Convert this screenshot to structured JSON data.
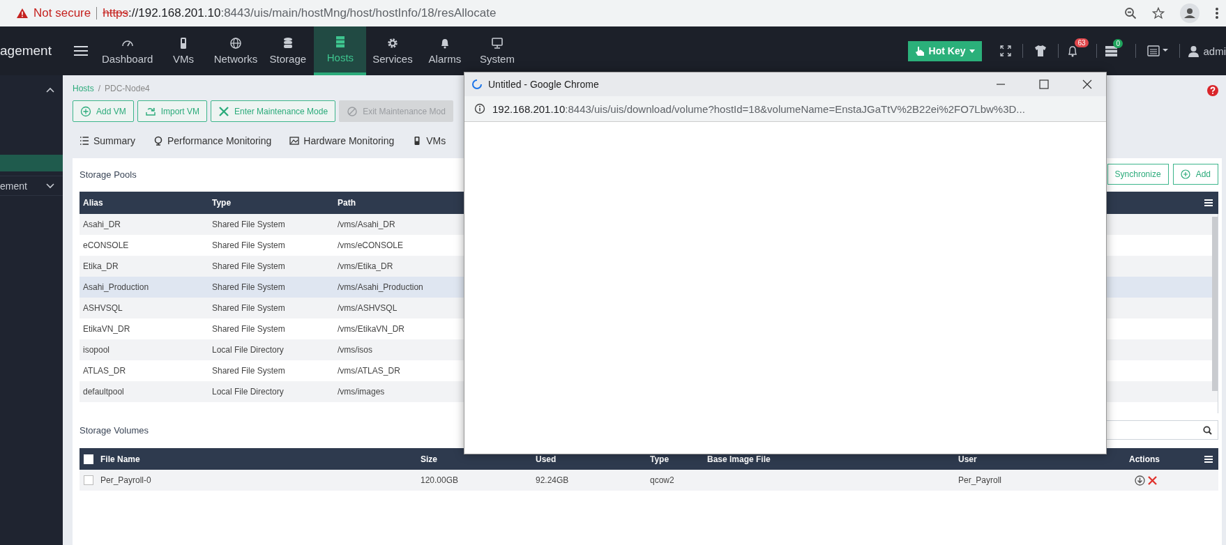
{
  "browser": {
    "security": "Not secure",
    "url": [
      {
        "kind": "scheme",
        "text": "https"
      },
      {
        "kind": "host",
        "text": "://192.168.201.10"
      },
      {
        "kind": "path",
        "text": ":8443/uis/main/hostMng/host/hostInfo/18/resAllocate"
      }
    ]
  },
  "topbar": {
    "brand": "agement",
    "nav": [
      {
        "label": "Dashboard",
        "selected": false
      },
      {
        "label": "VMs",
        "selected": false
      },
      {
        "label": "Networks",
        "selected": false
      },
      {
        "label": "Storage",
        "selected": false
      },
      {
        "label": "Hosts",
        "selected": true
      },
      {
        "label": "Services",
        "selected": false
      },
      {
        "label": "Alarms",
        "selected": false
      },
      {
        "label": "System",
        "selected": false
      }
    ],
    "hot_key": "Hot Key",
    "alarm_count": "63",
    "task_count": "0",
    "user": "admi"
  },
  "sidebar": {
    "groups": [
      {
        "expanded": true,
        "children": [
          {
            "selected": true
          }
        ]
      },
      {
        "label": "ement",
        "expanded": false
      }
    ]
  },
  "breadcrumb": {
    "items": [
      "Hosts",
      "PDC-Node4"
    ],
    "separator": "/"
  },
  "toolbar": [
    {
      "label": "Add VM",
      "disabled": false
    },
    {
      "label": "Import VM",
      "disabled": false
    },
    {
      "label": "Enter Maintenance Mode",
      "disabled": false
    },
    {
      "label": "Exit Maintenance Mod",
      "disabled": true
    }
  ],
  "tabs": [
    "Summary",
    "Performance Monitoring",
    "Hardware Monitoring",
    "VMs"
  ],
  "storage_pools": {
    "title": "Storage Pools",
    "buttons": [
      "Synchronize",
      "Add"
    ],
    "columns": [
      "Alias",
      "Type",
      "Path"
    ],
    "rows": [
      {
        "alias": "Asahi_DR",
        "type": "Shared File System",
        "path": "/vms/Asahi_DR",
        "selected": false
      },
      {
        "alias": "eCONSOLE",
        "type": "Shared File System",
        "path": "/vms/eCONSOLE",
        "selected": false
      },
      {
        "alias": "Etika_DR",
        "type": "Shared File System",
        "path": "/vms/Etika_DR",
        "selected": false
      },
      {
        "alias": "Asahi_Production",
        "type": "Shared File System",
        "path": "/vms/Asahi_Production",
        "selected": true
      },
      {
        "alias": "ASHVSQL",
        "type": "Shared File System",
        "path": "/vms/ASHVSQL",
        "selected": false
      },
      {
        "alias": "EtikaVN_DR",
        "type": "Shared File System",
        "path": "/vms/EtikaVN_DR",
        "selected": false
      },
      {
        "alias": "isopool",
        "type": "Local File Directory",
        "path": "/vms/isos",
        "selected": false
      },
      {
        "alias": "ATLAS_DR",
        "type": "Shared File System",
        "path": "/vms/ATLAS_DR",
        "selected": false
      },
      {
        "alias": "defaultpool",
        "type": "Local File Directory",
        "path": "/vms/images",
        "selected": false
      }
    ]
  },
  "storage_volumes": {
    "title": "Storage Volumes",
    "all_checked": false,
    "columns": [
      "File Name",
      "Size",
      "Used",
      "Type",
      "Base Image File",
      "User",
      "Actions"
    ],
    "rows": [
      {
        "file_name": "Per_Payroll-0",
        "size": "120.00GB",
        "used": "92.24GB",
        "type": "qcow2",
        "user": "Per_Payroll",
        "checked": false
      }
    ]
  },
  "popup": {
    "title": "Untitled - Google Chrome",
    "loading": true,
    "url": [
      {
        "kind": "host",
        "text": "192.168.201.10"
      },
      {
        "kind": "path",
        "text": ":8443/uis/uis/download/volume?hostId=18&volumeName=EnstaJGaTtV%2B22ei%2FO7Lbw%3D..."
      }
    ]
  }
}
